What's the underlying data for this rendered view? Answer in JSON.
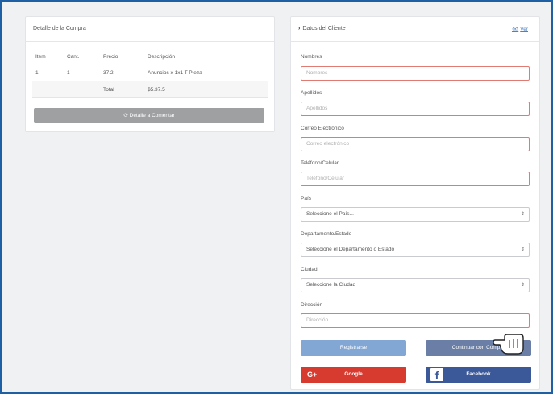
{
  "left_panel": {
    "title": "Detalle de la Compra",
    "columns": [
      "Item",
      "Cant.",
      "Precio",
      "Descripción"
    ],
    "rows": [
      [
        "1",
        "1",
        "37.2",
        "Anuncios x 1x1 T Pieza"
      ],
      [
        "",
        "",
        "Total",
        "$5.37.5"
      ]
    ],
    "update_button": "Detalle a Comentar"
  },
  "right_panel": {
    "title": "Datos del Cliente",
    "header_link": "Ver"
  },
  "form": {
    "nombre_label": "Nombres",
    "nombre_placeholder": "Nombres",
    "apellido_label": "Apellidos",
    "apellido_placeholder": "Apellidos",
    "correo_label": "Correo Electrónico",
    "correo_placeholder": "Correo electrónico",
    "telefono_label": "Teléfono/Celular",
    "telefono_placeholder": "Teléfono/Celular",
    "pais_label": "País",
    "pais_value": "Seleccione el País...",
    "depto_label": "Departamento/Estado",
    "depto_value": "Seleccione el Departamento o Estado",
    "ciudad_label": "Ciudad",
    "ciudad_value": "Seleccione la Ciudad",
    "direccion_label": "Dirección",
    "direccion_placeholder": "Dirección"
  },
  "buttons": {
    "register": "Registrarse",
    "continue": "Continuar con Compra",
    "google": "Google",
    "facebook": "Facebook"
  },
  "colors": {
    "frame_border": "#1f5fa3",
    "input_error_border": "#e07b72",
    "google": "#d73b30",
    "facebook": "#3b5898"
  }
}
